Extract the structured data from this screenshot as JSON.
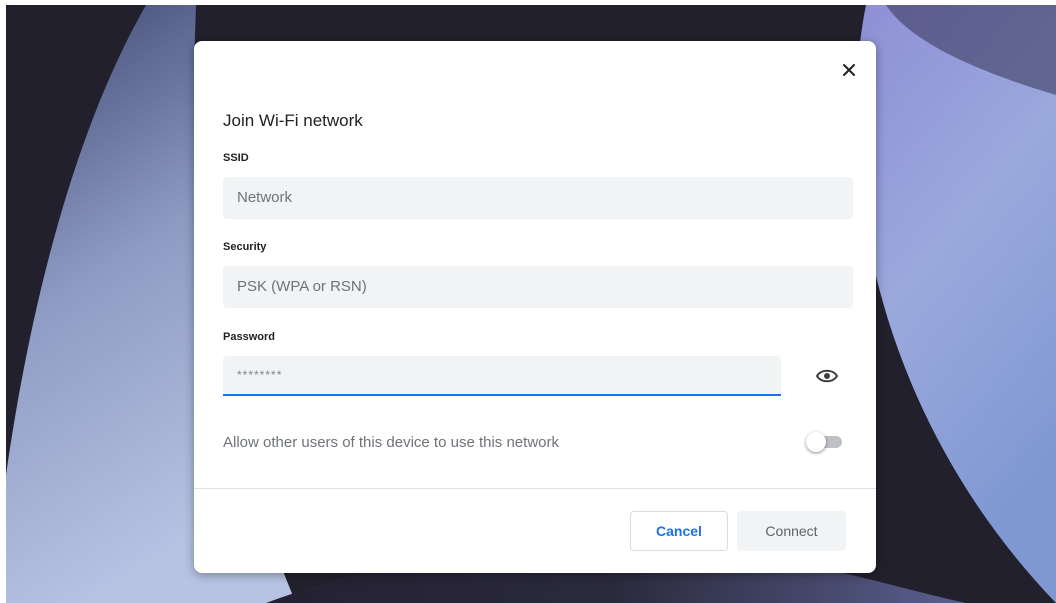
{
  "dialog": {
    "title": "Join Wi-Fi network",
    "close_icon": "close-icon",
    "ssid": {
      "label": "SSID",
      "value": "Network"
    },
    "security": {
      "label": "Security",
      "value": "PSK (WPA or RSN)"
    },
    "password": {
      "label": "Password",
      "value": "********",
      "visibility_icon": "eye-icon"
    },
    "share": {
      "label": "Allow other users of this device to use this network",
      "enabled": false
    },
    "buttons": {
      "cancel": "Cancel",
      "connect": "Connect"
    }
  },
  "colors": {
    "accent": "#1a73e8",
    "field_background": "#f1f3f4",
    "title_text": "#202124",
    "secondary_text": "#6f7378",
    "wallpaper_dark": "#22202c",
    "wallpaper_purple": "#3a3670",
    "wallpaper_blue": "#8ea2d8"
  }
}
